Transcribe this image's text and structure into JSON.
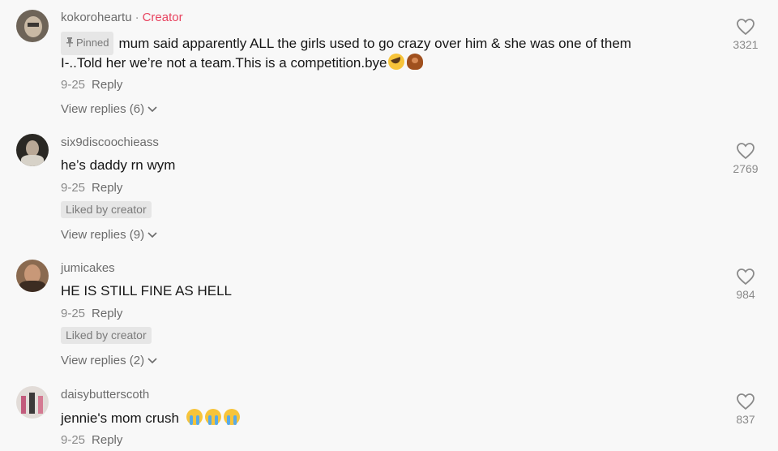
{
  "comments": [
    {
      "username": "kokoroheartu",
      "creator_label": "Creator",
      "pinned_label": "Pinned",
      "text_line1": "mum said apparently ALL the girls used to go crazy over him & she was one of them",
      "text_line2": "I-..Told her we’re not a team.This is a competition.bye",
      "date": "9-25",
      "reply_label": "Reply",
      "view_replies": "View replies (6)",
      "likes": "3321"
    },
    {
      "username": "six9discoochieass",
      "text_line1": "he’s daddy rn wym",
      "date": "9-25",
      "reply_label": "Reply",
      "liked_by": "Liked by creator",
      "view_replies": "View replies (9)",
      "likes": "2769"
    },
    {
      "username": "jumicakes",
      "text_line1": "HE IS STILL FINE AS HELL",
      "date": "9-25",
      "reply_label": "Reply",
      "liked_by": "Liked by creator",
      "view_replies": "View replies (2)",
      "likes": "984"
    },
    {
      "username": "daisybutterscoth",
      "text_line1": "jennie's mom crush",
      "date": "9-25",
      "reply_label": "Reply",
      "likes": "837"
    }
  ],
  "icons": {
    "heart": "heart-outline-icon",
    "chevron": "chevron-down-icon",
    "pin": "pin-icon"
  },
  "colors": {
    "creator": "#e8435f",
    "background": "#f8f8f8"
  }
}
